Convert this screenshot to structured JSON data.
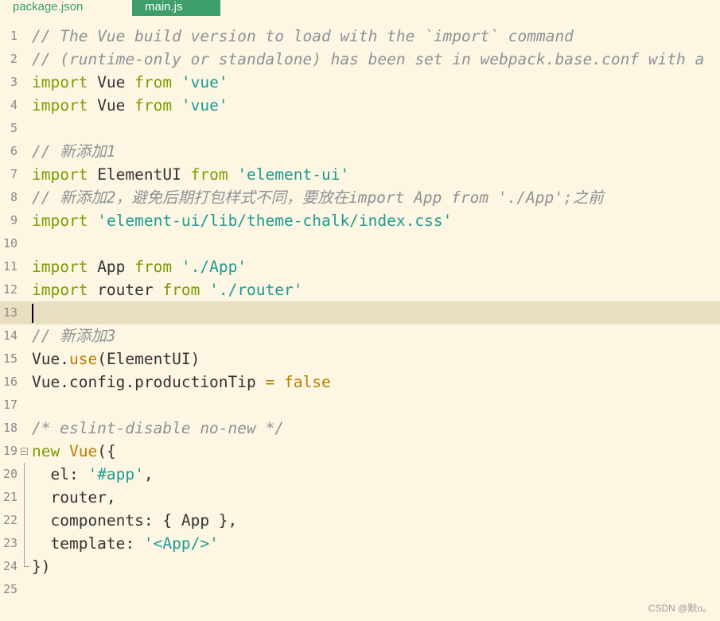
{
  "tabs": [
    {
      "label": "package.json",
      "active": false
    },
    {
      "label": "main.js",
      "active": true
    }
  ],
  "current_line": 13,
  "lines": [
    {
      "n": "1",
      "tokens": [
        {
          "t": "comment",
          "v": "// The Vue build version to load with the `import` command"
        }
      ]
    },
    {
      "n": "2",
      "tokens": [
        {
          "t": "comment",
          "v": "// (runtime-only or standalone) has been set in webpack.base.conf with a"
        }
      ]
    },
    {
      "n": "3",
      "tokens": [
        {
          "t": "keyword",
          "v": "import"
        },
        {
          "t": "plain",
          "v": " Vue "
        },
        {
          "t": "keyword",
          "v": "from"
        },
        {
          "t": "plain",
          "v": " "
        },
        {
          "t": "string",
          "v": "'vue'"
        }
      ]
    },
    {
      "n": "4",
      "tokens": [
        {
          "t": "keyword",
          "v": "import"
        },
        {
          "t": "plain",
          "v": " Vue "
        },
        {
          "t": "keyword",
          "v": "from"
        },
        {
          "t": "plain",
          "v": " "
        },
        {
          "t": "string",
          "v": "'vue'"
        }
      ]
    },
    {
      "n": "5",
      "tokens": []
    },
    {
      "n": "6",
      "tokens": [
        {
          "t": "comment",
          "v": "// 新添加1"
        }
      ]
    },
    {
      "n": "7",
      "tokens": [
        {
          "t": "keyword",
          "v": "import"
        },
        {
          "t": "plain",
          "v": " ElementUI "
        },
        {
          "t": "keyword",
          "v": "from"
        },
        {
          "t": "plain",
          "v": " "
        },
        {
          "t": "string",
          "v": "'element-ui'"
        }
      ]
    },
    {
      "n": "8",
      "tokens": [
        {
          "t": "comment",
          "v": "// 新添加2，避免后期打包样式不同，要放在import App from './App';之前"
        }
      ]
    },
    {
      "n": "9",
      "tokens": [
        {
          "t": "keyword",
          "v": "import"
        },
        {
          "t": "plain",
          "v": " "
        },
        {
          "t": "string",
          "v": "'element-ui/lib/theme-chalk/index.css'"
        }
      ]
    },
    {
      "n": "10",
      "tokens": []
    },
    {
      "n": "11",
      "tokens": [
        {
          "t": "keyword",
          "v": "import"
        },
        {
          "t": "plain",
          "v": " App "
        },
        {
          "t": "keyword",
          "v": "from"
        },
        {
          "t": "plain",
          "v": " "
        },
        {
          "t": "string",
          "v": "'./App'"
        }
      ]
    },
    {
      "n": "12",
      "tokens": [
        {
          "t": "keyword",
          "v": "import"
        },
        {
          "t": "plain",
          "v": " router "
        },
        {
          "t": "keyword",
          "v": "from"
        },
        {
          "t": "plain",
          "v": " "
        },
        {
          "t": "string",
          "v": "'./router'"
        }
      ]
    },
    {
      "n": "13",
      "tokens": []
    },
    {
      "n": "14",
      "tokens": [
        {
          "t": "comment",
          "v": "// 新添加3"
        }
      ]
    },
    {
      "n": "15",
      "tokens": [
        {
          "t": "plain",
          "v": "Vue."
        },
        {
          "t": "func",
          "v": "use"
        },
        {
          "t": "plain",
          "v": "(ElementUI)"
        }
      ]
    },
    {
      "n": "16",
      "tokens": [
        {
          "t": "plain",
          "v": "Vue.config.productionTip "
        },
        {
          "t": "op",
          "v": "="
        },
        {
          "t": "plain",
          "v": " "
        },
        {
          "t": "bool",
          "v": "false"
        }
      ]
    },
    {
      "n": "17",
      "tokens": []
    },
    {
      "n": "18",
      "tokens": [
        {
          "t": "comment",
          "v": "/* eslint-disable no-new */"
        }
      ]
    },
    {
      "n": "19",
      "fold": "start",
      "tokens": [
        {
          "t": "keyword",
          "v": "new"
        },
        {
          "t": "plain",
          "v": " "
        },
        {
          "t": "func",
          "v": "Vue"
        },
        {
          "t": "plain",
          "v": "({"
        }
      ]
    },
    {
      "n": "20",
      "fold": "rail",
      "tokens": [
        {
          "t": "plain",
          "v": "  el: "
        },
        {
          "t": "string",
          "v": "'#app'"
        },
        {
          "t": "plain",
          "v": ","
        }
      ]
    },
    {
      "n": "21",
      "fold": "rail",
      "tokens": [
        {
          "t": "plain",
          "v": "  router,"
        }
      ]
    },
    {
      "n": "22",
      "fold": "rail",
      "tokens": [
        {
          "t": "plain",
          "v": "  components: { App },"
        }
      ]
    },
    {
      "n": "23",
      "fold": "rail",
      "tokens": [
        {
          "t": "plain",
          "v": "  template: "
        },
        {
          "t": "string",
          "v": "'<App/>'"
        }
      ]
    },
    {
      "n": "24",
      "fold": "end",
      "tokens": [
        {
          "t": "plain",
          "v": "})"
        }
      ]
    },
    {
      "n": "25",
      "tokens": []
    }
  ],
  "watermark": "CSDN @默o。"
}
